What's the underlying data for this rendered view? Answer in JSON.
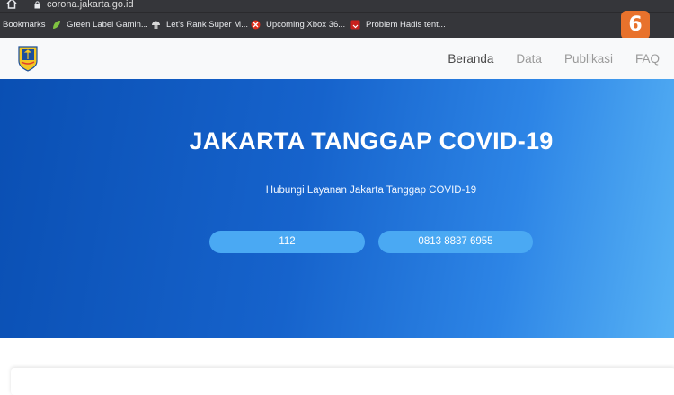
{
  "browser": {
    "url": "corona.jakarta.go.id",
    "bookmarks_label": "Bookmarks",
    "bookmarks": [
      {
        "label": "Green Label Gamin...",
        "icon": "leaf-icon"
      },
      {
        "label": "Let's Rank Super M...",
        "icon": "mushroom-icon"
      },
      {
        "label": "Upcoming Xbox 36...",
        "icon": "xbox-icon"
      },
      {
        "label": "Problem Hadis tent...",
        "icon": "bookmark-red-icon"
      }
    ],
    "watermark": "6"
  },
  "site": {
    "nav": [
      {
        "label": "Beranda",
        "active": true
      },
      {
        "label": "Data",
        "active": false
      },
      {
        "label": "Publikasi",
        "active": false
      },
      {
        "label": "FAQ",
        "active": false
      }
    ]
  },
  "hero": {
    "title": "JAKARTA TANGGAP COVID-19",
    "subtitle": "Hubungi Layanan Jakarta Tanggap COVID-19",
    "buttons": [
      "112",
      "0813 8837 6955"
    ]
  },
  "colors": {
    "chrome": "#35363a",
    "hero_start": "#0a4fb3",
    "hero_end": "#57b2f5",
    "pill": "#4aa9f3",
    "nav_active": "#4a4a4a",
    "nav_inactive": "#9a9a9a"
  }
}
